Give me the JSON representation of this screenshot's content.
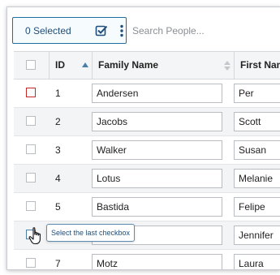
{
  "toolbar": {
    "selected_label": "0 Selected",
    "select_icon": "checkbox-check-icon",
    "menu_icon": "more-vertical-icon",
    "search_placeholder": "Search People..."
  },
  "table": {
    "columns": [
      {
        "key": "select",
        "label": ""
      },
      {
        "key": "id",
        "label": "ID",
        "sort": "ascending"
      },
      {
        "key": "family_name",
        "label": "Family Name",
        "sort": "unsorted"
      },
      {
        "key": "first_name",
        "label": "First Nam"
      }
    ],
    "rows": [
      {
        "id": "1",
        "family_name": "Andersen",
        "first_name": "Per",
        "checkbox_state": "error"
      },
      {
        "id": "2",
        "family_name": "Jacobs",
        "first_name": "Scott",
        "checkbox_state": "default"
      },
      {
        "id": "3",
        "family_name": "Walker",
        "first_name": "Susan",
        "checkbox_state": "default"
      },
      {
        "id": "4",
        "family_name": "Lotus",
        "first_name": "Melanie",
        "checkbox_state": "default"
      },
      {
        "id": "5",
        "family_name": "Bastida",
        "first_name": "Felipe",
        "checkbox_state": "default"
      },
      {
        "id": "6",
        "family_name": "",
        "first_name": "Jennifer",
        "checkbox_state": "hover"
      },
      {
        "id": "7",
        "family_name": "Motz",
        "first_name": "Laura",
        "checkbox_state": "default"
      }
    ]
  },
  "tooltip": {
    "text": "Select the last checkbox"
  },
  "colors": {
    "accent": "#1f6f9e",
    "error": "#c62828",
    "header_bg": "#f4f5f6",
    "row_alt": "#f3f4f5"
  }
}
